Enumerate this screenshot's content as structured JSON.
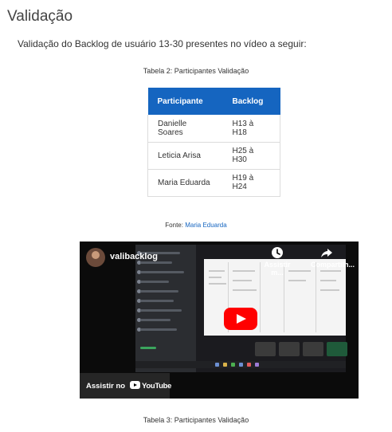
{
  "section_title": "Validação",
  "intro_text": "Validação do Backlog de usuário 13-30 presentes no vídeo a seguir:",
  "table2": {
    "caption": "Tabela 2: Participantes Validação",
    "headers": [
      "Participante",
      "Backlog"
    ],
    "rows": [
      {
        "participant": "Danielle Soares",
        "backlog": "H13 à H18"
      },
      {
        "participant": "Leticia Arisa",
        "backlog": "H25 à H30"
      },
      {
        "participant": "Maria Eduarda",
        "backlog": "H19 à H24"
      }
    ],
    "source_prefix": "Fonte:",
    "source_name": "Maria Eduarda"
  },
  "video": {
    "title": "valibacklog",
    "watch_later_label": "Assistir m...",
    "share_label": "Compartilh...",
    "watch_on_label": "Assistir no",
    "youtube_label": "YouTube",
    "icons": [
      "avatar",
      "clock-icon",
      "share-icon",
      "play-icon",
      "youtube-icon"
    ],
    "play_color": "#ff0000"
  },
  "table3": {
    "caption": "Tabela 3: Participantes Validação"
  },
  "colors": {
    "table_header": "#1565c0",
    "link": "#1565c0"
  }
}
